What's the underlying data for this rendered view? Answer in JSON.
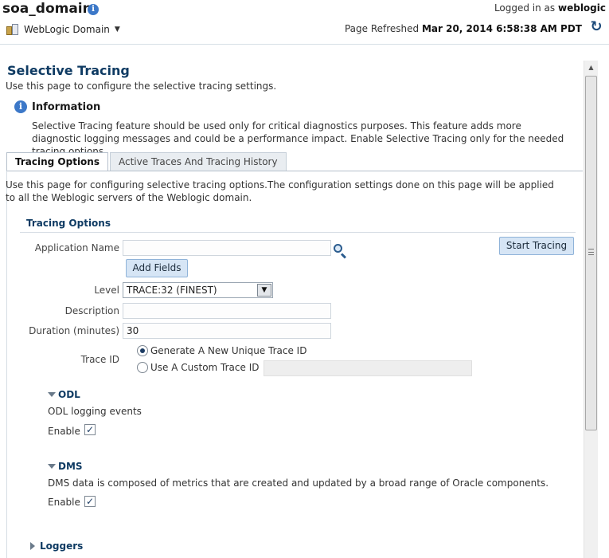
{
  "header": {
    "domain_title": "soa_domain",
    "info_icon": "info-icon",
    "logged_in_label": "Logged in as",
    "user": "weblogic",
    "domain_menu_label": "WebLogic Domain",
    "page_refreshed_label": "Page Refreshed",
    "page_refreshed_value": "Mar 20, 2014 6:58:38 AM PDT"
  },
  "page": {
    "title": "Selective Tracing",
    "description": "Use this page to configure the selective tracing settings.",
    "info": {
      "title": "Information",
      "text": "Selective Tracing feature should be used only for critical diagnostics purposes. This feature adds more diagnostic logging messages and could be a performance impact. Enable Selective Tracing only for the needed tracing options."
    }
  },
  "tabs": [
    {
      "label": "Tracing Options",
      "active": true
    },
    {
      "label": "Active Traces And Tracing History",
      "active": false
    }
  ],
  "tracing": {
    "panel_description": "Use this page for configuring selective tracing options.The configuration settings done on this page will be applied to all the Weblogic servers of the Weblogic domain.",
    "section_title": "Tracing Options",
    "application_name_label": "Application Name",
    "application_name_value": "",
    "add_fields_label": "Add Fields",
    "start_tracing_label": "Start Tracing",
    "level_label": "Level",
    "level_value": "TRACE:32 (FINEST)",
    "description_label": "Description",
    "description_value": "",
    "duration_label": "Duration (minutes)",
    "duration_value": "30",
    "trace_id_label": "Trace ID",
    "trace_id_options": [
      {
        "label": "Generate A New Unique Trace ID",
        "selected": true
      },
      {
        "label": "Use A Custom Trace ID",
        "selected": false
      }
    ],
    "custom_trace_id_value": ""
  },
  "odl": {
    "title": "ODL",
    "description": "ODL logging events",
    "enable_label": "Enable",
    "enabled": true
  },
  "dms": {
    "title": "DMS",
    "description": "DMS data is composed of metrics that are created and updated by a broad range of Oracle components.",
    "enable_label": "Enable",
    "enabled": true
  },
  "loggers": {
    "title": "Loggers"
  },
  "colors": {
    "accent": "#0f3b63",
    "button_bg": "#d6e5f5",
    "button_border": "#8fb3d9",
    "info_blue": "#3c78c8"
  }
}
